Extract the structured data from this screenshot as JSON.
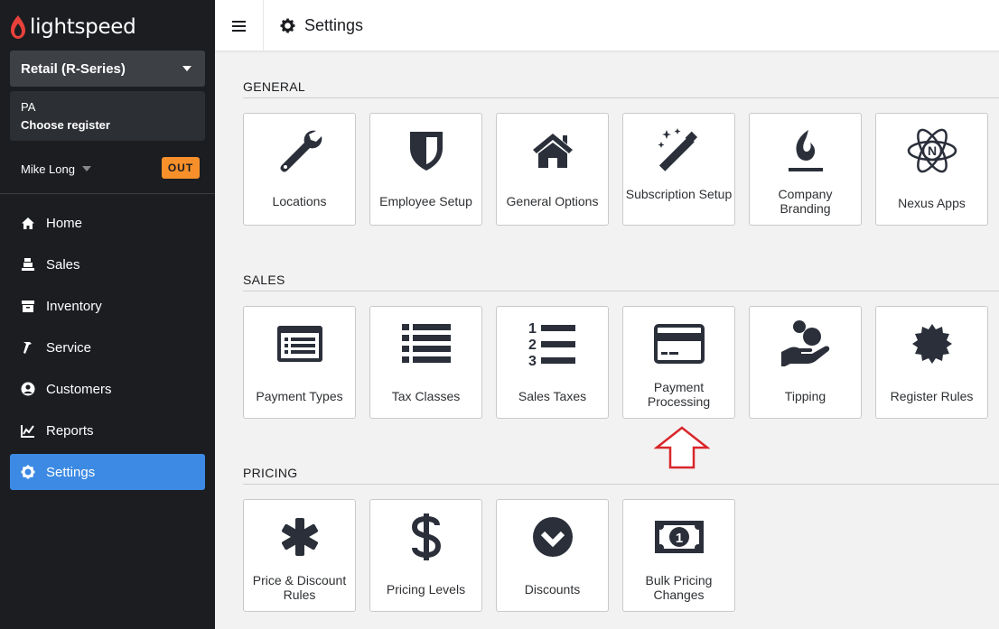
{
  "app": {
    "logo_text": "lightspeed"
  },
  "sidebar": {
    "store_selector": "Retail (R-Series)",
    "register": {
      "location": "PA",
      "action": "Choose register"
    },
    "user": {
      "name": "Mike Long",
      "status_badge": "OUT"
    },
    "nav": [
      {
        "label": "Home",
        "icon": "home-icon"
      },
      {
        "label": "Sales",
        "icon": "cash-register-icon"
      },
      {
        "label": "Inventory",
        "icon": "archive-icon"
      },
      {
        "label": "Service",
        "icon": "hammer-icon"
      },
      {
        "label": "Customers",
        "icon": "user-circle-icon"
      },
      {
        "label": "Reports",
        "icon": "chart-line-icon"
      },
      {
        "label": "Settings",
        "icon": "gear-icon",
        "active": true
      }
    ]
  },
  "header": {
    "title": "Settings"
  },
  "sections": {
    "general": {
      "title": "GENERAL",
      "tiles": [
        {
          "label": "Locations",
          "icon": "wrench-icon"
        },
        {
          "label": "Employee Setup",
          "icon": "shield-icon"
        },
        {
          "label": "General Options",
          "icon": "home-icon"
        },
        {
          "label": "Subscription Setup",
          "icon": "magic-wand-icon"
        },
        {
          "label": "Company Branding",
          "icon": "flame-icon"
        },
        {
          "label": "Nexus Apps",
          "icon": "atom-icon"
        }
      ]
    },
    "sales": {
      "title": "SALES",
      "tiles": [
        {
          "label": "Payment Types",
          "icon": "list-card-icon"
        },
        {
          "label": "Tax Classes",
          "icon": "list-icon"
        },
        {
          "label": "Sales Taxes",
          "icon": "numbered-list-icon"
        },
        {
          "label": "Payment Processing",
          "icon": "credit-card-icon"
        },
        {
          "label": "Tipping",
          "icon": "hand-coins-icon"
        },
        {
          "label": "Register Rules",
          "icon": "certificate-icon"
        }
      ]
    },
    "pricing": {
      "title": "PRICING",
      "tiles": [
        {
          "label": "Price & Discount Rules",
          "icon": "asterisk-icon"
        },
        {
          "label": "Pricing Levels",
          "icon": "dollar-icon"
        },
        {
          "label": "Discounts",
          "icon": "chevron-circle-icon"
        },
        {
          "label": "Bulk Pricing Changes",
          "icon": "money-bill-icon"
        }
      ]
    }
  },
  "colors": {
    "sidebar_bg": "#1b1d21",
    "active_nav": "#3c8ae3",
    "badge": "#f7902a",
    "annotation_arrow": "#d9262b"
  }
}
